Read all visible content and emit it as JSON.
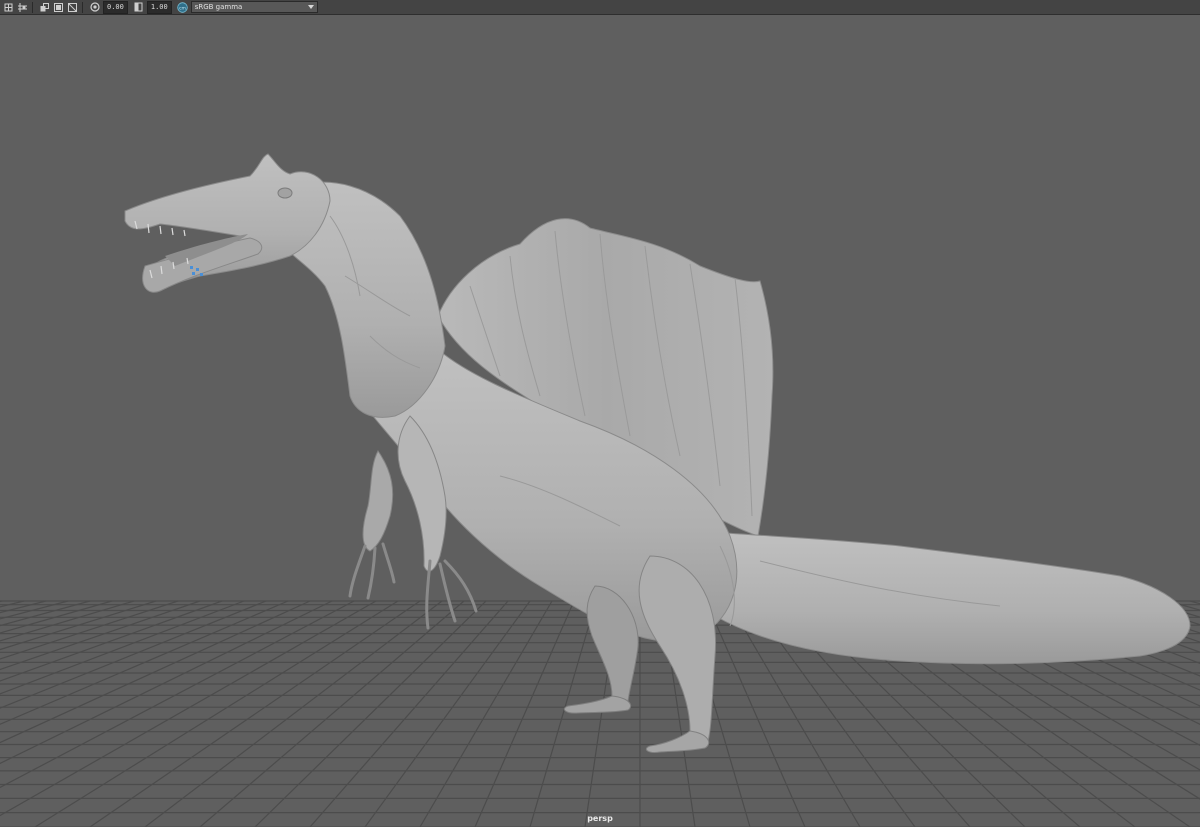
{
  "toolbar": {
    "exposure_value": "0.00",
    "gamma_value": "1.00",
    "color_space": "sRGB gamma",
    "icons": [
      "grid-icon",
      "resolution-gate-icon",
      "film-gate-icon",
      "safe-action-icon",
      "exposure-icon",
      "gamma-icon",
      "color-management-icon"
    ]
  },
  "viewport": {
    "camera_label": "persp",
    "model": "spinosaurus-sculpt"
  },
  "colors": {
    "background": "#5f5f5f",
    "grid": "#4a4a4a",
    "model": "#b4b4b4",
    "toolbar": "#444444"
  }
}
